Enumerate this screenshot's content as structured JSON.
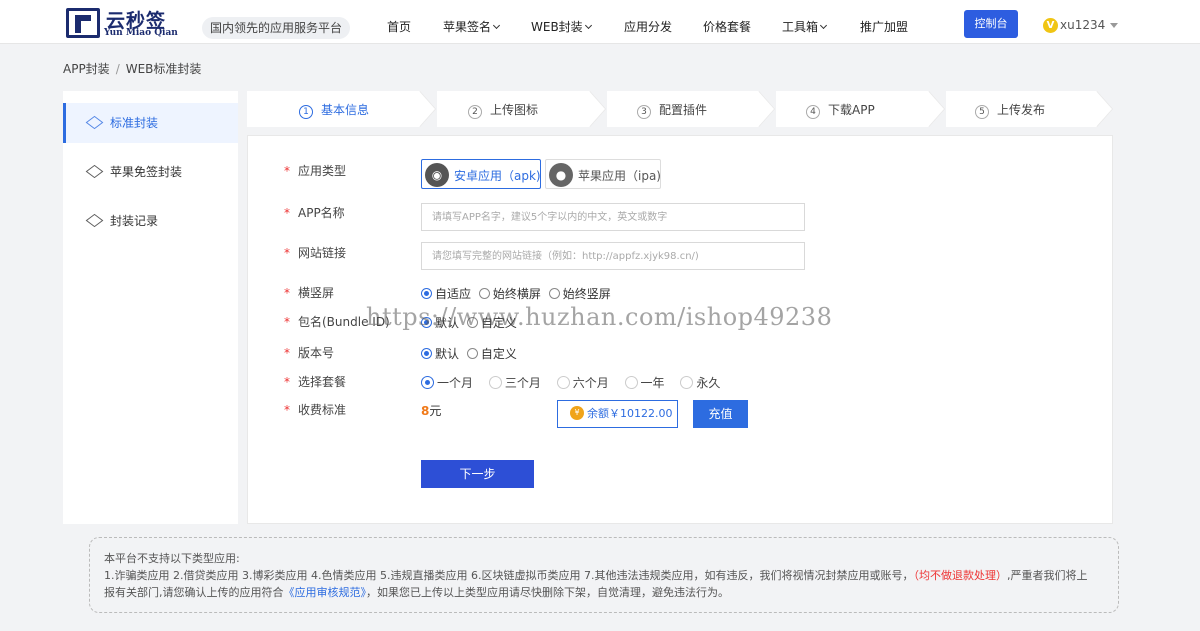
{
  "header": {
    "logo_cn": "云秒签",
    "logo_en": "Yun Miao Qian",
    "slogan": "国内领先的应用服务平台",
    "nav": [
      {
        "label": "首页",
        "has_caret": false
      },
      {
        "label": "苹果签名",
        "has_caret": true
      },
      {
        "label": "WEB封装",
        "has_caret": true
      },
      {
        "label": "应用分发",
        "has_caret": false
      },
      {
        "label": "价格套餐",
        "has_caret": false
      },
      {
        "label": "工具箱",
        "has_caret": true
      },
      {
        "label": "推广加盟",
        "has_caret": false
      }
    ],
    "console_label": "控制台",
    "vip_badge": "V",
    "username": "xu1234"
  },
  "breadcrumb": {
    "parent": "APP封装",
    "separator": "/",
    "current": "WEB标准封装"
  },
  "sidebar": {
    "items": [
      {
        "label": "标准封装",
        "active": true
      },
      {
        "label": "苹果免签封装",
        "active": false
      },
      {
        "label": "封装记录",
        "active": false
      }
    ]
  },
  "steps": [
    {
      "num": "1",
      "label": "基本信息",
      "active": true
    },
    {
      "num": "2",
      "label": "上传图标",
      "active": false
    },
    {
      "num": "3",
      "label": "配置插件",
      "active": false
    },
    {
      "num": "4",
      "label": "下载APP",
      "active": false
    },
    {
      "num": "5",
      "label": "上传发布",
      "active": false
    }
  ],
  "form": {
    "required_mark": "*",
    "app_type": {
      "label": "应用类型",
      "options": [
        {
          "label": "安卓应用（apk)",
          "icon": "android-icon",
          "selected": true
        },
        {
          "label": "苹果应用（ipa)",
          "icon": "apple-icon",
          "selected": false
        }
      ]
    },
    "app_name": {
      "label": "APP名称",
      "value": "",
      "placeholder": "请填写APP名字，建议5个字以内的中文，英文或数字"
    },
    "site_url": {
      "label": "网站链接",
      "value": "",
      "placeholder": "请您填写完整的网站链接（例如：http://appfz.xjyk98.cn/)"
    },
    "orientation": {
      "label": "横竖屏",
      "options": [
        {
          "label": "自适应",
          "checked": true
        },
        {
          "label": "始终横屏",
          "checked": false
        },
        {
          "label": "始终竖屏",
          "checked": false
        }
      ]
    },
    "bundle": {
      "label": "包名(Bundle ID)",
      "options": [
        {
          "label": "默认",
          "checked": true
        },
        {
          "label": "自定义",
          "checked": false
        }
      ]
    },
    "version": {
      "label": "版本号",
      "options": [
        {
          "label": "默认",
          "checked": true
        },
        {
          "label": "自定义",
          "checked": false
        }
      ]
    },
    "package": {
      "label": "选择套餐",
      "options": [
        {
          "label": "一个月",
          "checked": true
        },
        {
          "label": "三个月",
          "checked": false
        },
        {
          "label": "六个月",
          "checked": false
        },
        {
          "label": "一年",
          "checked": false
        },
        {
          "label": "永久",
          "checked": false
        }
      ]
    },
    "fee": {
      "label": "收费标准",
      "amount": "8",
      "unit": "元",
      "balance_label": "余额￥10122.00",
      "recharge_label": "充值"
    },
    "next_label": "下一步"
  },
  "notice": {
    "line1": "本平台不支持以下类型应用:",
    "line2_a": "1.诈骗类应用 2.借贷类应用 3.博彩类应用 4.色情类应用 5.违规直播类应用 6.区块链虚拟币类应用 7.其他违法违规类应用，如有违反，我们将视情况封禁应用或账号，",
    "line2_red": "（均不做退款处理）",
    "line2_b": ",严重者我们将上",
    "line3_a": "报有关部门,请您确认上传的应用符合",
    "line3_link": "《应用审核规范》",
    "line3_b": "，如果您已上传以上类型应用请尽快删除下架，自觉清理，避免违法行为。"
  },
  "watermark": "https://www.huzhan.com/ishop49238",
  "colors": {
    "accent": "#2d6ce0",
    "button_dark": "#2d4fd6",
    "required": "#e33333",
    "price": "#f07a1a",
    "brand": "#1b2b6e"
  }
}
